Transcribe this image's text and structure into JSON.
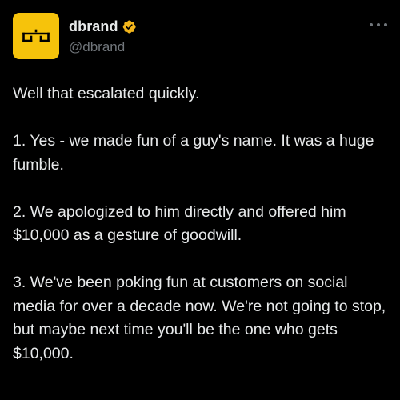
{
  "author": {
    "display_name": "dbrand",
    "handle": "@dbrand",
    "avatar_icon": "dbrand-logo-icon",
    "verified_icon": "verified-badge-icon",
    "avatar_color": "#f6c30b",
    "badge_color": "#f2b51b"
  },
  "menu": {
    "icon": "more-options-icon"
  },
  "tweet": {
    "paragraphs": [
      "Well that escalated quickly.",
      "1. Yes - we made fun of a guy's name. It was a huge fumble.",
      "2. We apologized to him directly and offered him $10,000 as a gesture of goodwill.",
      "3. We've been poking fun at customers on social media for over a decade now. We're not going to stop, but maybe next time you'll be the one who gets $10,000."
    ]
  }
}
